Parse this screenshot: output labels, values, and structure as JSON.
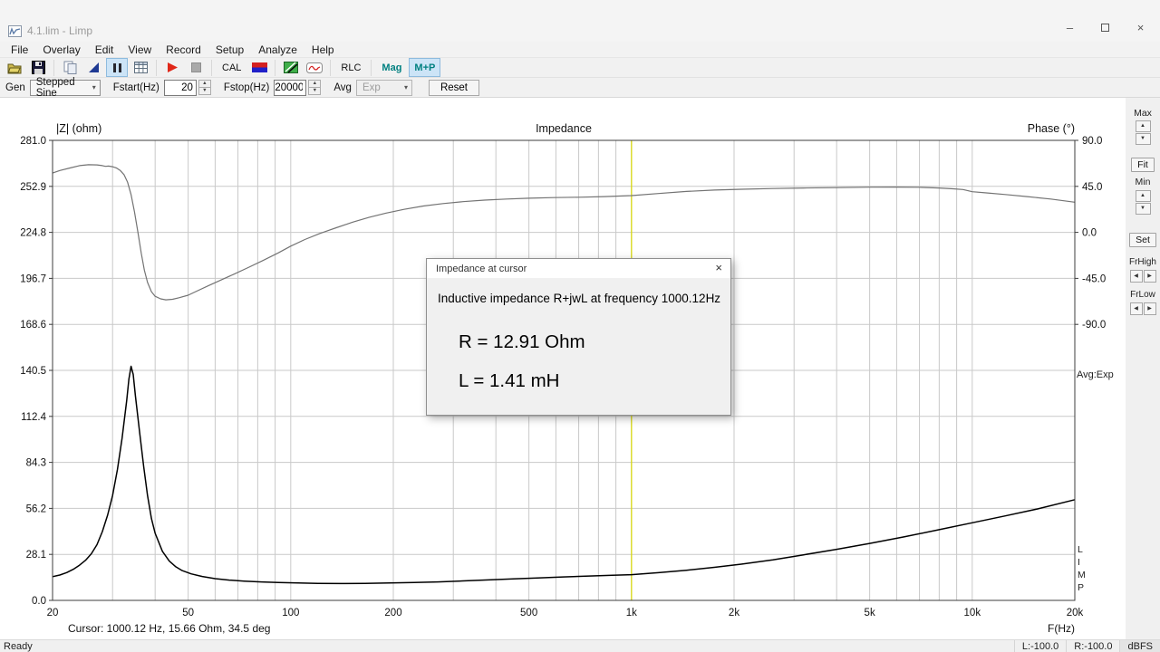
{
  "window": {
    "title": "4.1.lim - Limp",
    "minimize_glyph": "–",
    "close_glyph": "×"
  },
  "menu": {
    "items": [
      "File",
      "Overlay",
      "Edit",
      "View",
      "Record",
      "Setup",
      "Analyze",
      "Help"
    ]
  },
  "toolbar": {
    "icons": [
      "open-folder",
      "save",
      "copy",
      "overlay",
      "pause",
      "table",
      "play",
      "stop",
      "flag",
      "generator",
      "scope"
    ],
    "cal_label": "CAL",
    "rlc_label": "RLC",
    "mag_label": "Mag",
    "mp_label": "M+P"
  },
  "params": {
    "gen_label": "Gen",
    "gen_value": "Stepped Sine",
    "fstart_label": "Fstart(Hz)",
    "fstart_value": "20",
    "fstop_label": "Fstop(Hz)",
    "fstop_value": "20000",
    "avg_label": "Avg",
    "avg_value": "Exp",
    "reset_label": "Reset"
  },
  "chart": {
    "title": "Impedance",
    "left_axis": "|Z| (ohm)",
    "right_axis": "Phase (°)",
    "x_axis": "F(Hz)",
    "avg_note": "Avg:Exp",
    "limp_vertical": "LIMP",
    "z_labels": [
      "281.0",
      "252.9",
      "224.8",
      "196.7",
      "168.6",
      "140.5",
      "112.4",
      "84.3",
      "56.2",
      "28.1",
      "0.0"
    ],
    "phase_labels": [
      "90.0",
      "45.0",
      "0.0",
      "-45.0",
      "-90.0"
    ],
    "freq_ticks": [
      {
        "f": 20,
        "label": "20"
      },
      {
        "f": 50,
        "label": "50"
      },
      {
        "f": 100,
        "label": "100"
      },
      {
        "f": 200,
        "label": "200"
      },
      {
        "f": 500,
        "label": "500"
      },
      {
        "f": 1000,
        "label": "1k"
      },
      {
        "f": 2000,
        "label": "2k"
      },
      {
        "f": 5000,
        "label": "5k"
      },
      {
        "f": 10000,
        "label": "10k"
      },
      {
        "f": 20000,
        "label": "20k"
      }
    ],
    "minor_gridline_freqs": [
      30,
      40,
      50,
      60,
      70,
      80,
      90,
      100,
      200,
      300,
      400,
      500,
      600,
      700,
      800,
      900,
      1000,
      2000,
      3000,
      4000,
      5000,
      6000,
      7000,
      8000,
      9000,
      10000
    ]
  },
  "chart_data": {
    "type": "line",
    "title": "Impedance",
    "xlabel": "F(Hz)",
    "x_scale": "log",
    "x_range_hz": [
      20,
      20000
    ],
    "y_left": {
      "label": "|Z| (ohm)",
      "min": 0,
      "max": 281,
      "major_step": 28.1
    },
    "y_right": {
      "label": "Phase (°)",
      "labels_deg": [
        90,
        45,
        0,
        -45,
        -90
      ],
      "deg_per_division": 45
    },
    "grid": true,
    "cursor": {
      "freq_hz": 1000.12,
      "impedance_ohm": 15.66,
      "phase_deg": 34.5,
      "r_ohm": 12.91,
      "l_mh": 1.41
    },
    "series": [
      {
        "name": "impedance-magnitude",
        "unit": "ohm",
        "color": "#000000",
        "x": [
          20,
          21,
          22,
          23,
          24,
          25,
          26,
          27,
          28,
          29,
          30,
          31,
          32,
          33,
          33.5,
          34,
          34.5,
          35,
          36,
          37,
          38,
          39,
          40,
          42,
          44,
          46,
          48,
          51,
          55,
          60,
          66,
          73,
          82,
          92,
          105,
          120,
          140,
          165,
          195,
          230,
          270,
          320,
          380,
          450,
          530,
          630,
          750,
          880,
          1000,
          1200,
          1450,
          1750,
          2100,
          2600,
          3200,
          4000,
          5000,
          6300,
          8000,
          10000,
          12500,
          15500,
          20000
        ],
        "y": [
          14.5,
          15.5,
          17,
          19,
          21.5,
          24.5,
          28.5,
          34,
          42,
          52,
          64,
          80,
          99,
          122,
          135,
          143,
          138,
          125,
          103,
          82,
          64,
          50,
          41,
          30,
          24,
          20.5,
          18.2,
          16.2,
          14.6,
          13.3,
          12.4,
          11.8,
          11.3,
          10.9,
          10.6,
          10.4,
          10.3,
          10.4,
          10.6,
          10.9,
          11.3,
          11.9,
          12.5,
          13.1,
          13.7,
          14.3,
          14.9,
          15.3,
          15.7,
          16.9,
          18.4,
          20.2,
          22.1,
          24.8,
          27.8,
          31.2,
          34.8,
          38.8,
          43.2,
          47.4,
          51.6,
          55.8,
          61.5
        ]
      },
      {
        "name": "phase",
        "unit": "deg",
        "color": "#737373",
        "x": [
          20,
          21,
          22.5,
          24,
          25.5,
          27,
          28,
          28.6,
          29.2,
          30,
          30.8,
          31.6,
          32.4,
          33.2,
          34,
          34.8,
          35.6,
          36.4,
          37.2,
          38,
          39,
          40,
          41.5,
          43,
          45,
          47,
          50,
          53,
          57,
          62,
          68,
          75,
          83,
          92,
          100,
          110,
          122,
          136,
          152,
          170,
          190,
          215,
          245,
          280,
          320,
          370,
          430,
          500,
          590,
          700,
          830,
          1000,
          1200,
          1450,
          1750,
          2100,
          2600,
          3200,
          4000,
          5000,
          6000,
          7000,
          8000,
          8800,
          9400,
          10000,
          11000,
          12500,
          14500,
          17000,
          20000
        ],
        "y": [
          58,
          60.5,
          63,
          65.3,
          66.2,
          66,
          65.3,
          64.6,
          64.8,
          64.2,
          63,
          60.5,
          56.5,
          49,
          37,
          20,
          0,
          -20,
          -37,
          -49,
          -58,
          -62.5,
          -65,
          -66,
          -65.5,
          -64,
          -61.5,
          -57.5,
          -52.5,
          -47,
          -41,
          -34.5,
          -27.5,
          -20,
          -13.5,
          -7,
          -1,
          4.5,
          10,
          14.8,
          18.8,
          22.5,
          25.8,
          28.2,
          30,
          31.5,
          32.6,
          33.4,
          34,
          34.4,
          35,
          36,
          38,
          40,
          41.4,
          42.2,
          42.9,
          43.4,
          43.8,
          44.2,
          44.3,
          44.1,
          43.4,
          42.6,
          41.9,
          39.8,
          38.6,
          37,
          35,
          32.6,
          29.5
        ]
      }
    ]
  },
  "dialog": {
    "title": "Impedance at cursor",
    "close_glyph": "×",
    "line1": "Inductive impedance R+jwL at frequency 1000.12Hz",
    "r_value": "R = 12.91 Ohm",
    "l_value": "L = 1.41 mH"
  },
  "side_panel": {
    "max_label": "Max",
    "fit_label": "Fit",
    "min_label": "Min",
    "set_label": "Set",
    "frhigh_label": "FrHigh",
    "frlow_label": "FrLow"
  },
  "status": {
    "ready": "Ready",
    "cursor_readout": "Cursor: 1000.12 Hz, 15.66 Ohm, 34.5 deg",
    "l_level": "L:-100.0",
    "r_level": "R:-100.0",
    "unit": "dBFS"
  },
  "colors": {
    "active_toggle_bg": "#cce4f7",
    "active_toggle_border": "#8ebbde",
    "teal_text": "#008080",
    "cursor_line": "#d9d900",
    "grid_line": "#c9c9c9",
    "plot_border": "#3c3c3c",
    "mag_curve": "#000000",
    "phase_curve": "#737373",
    "play_red": "#e02718",
    "flag_red": "#d42020",
    "flag_blue": "#2020c8"
  }
}
